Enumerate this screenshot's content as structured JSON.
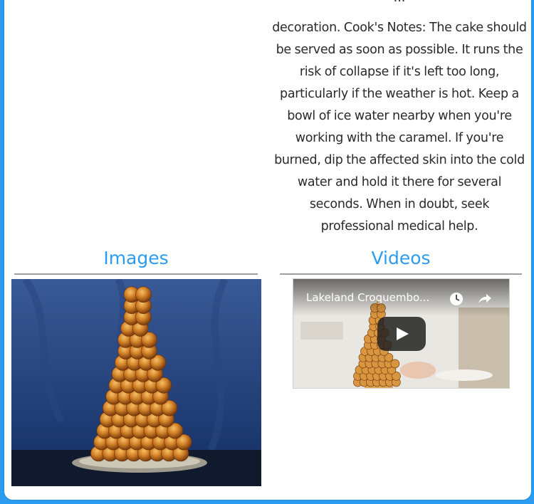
{
  "notes": {
    "partial_top": "...",
    "text": "decoration. Cook's Notes: The cake should be served as soon as possible. It runs the risk of collapse if it's left too long, particularly if the weather is hot. Keep a bowl of ice water nearby when you're working with the caramel. If you're burned, dip the affected skin into the cold water and hold it there for several seconds. When in doubt, seek professional medical help."
  },
  "images": {
    "title": "Images",
    "photo_icon": "croquembouche-photo"
  },
  "videos": {
    "title": "Videos",
    "video_title": "Lakeland Croquembo...",
    "icons": [
      "clock-icon",
      "share-icon",
      "play-icon"
    ]
  },
  "colors": {
    "accent": "#2b9cf0",
    "rule": "#9e9e9e",
    "text": "#2a2a2a"
  }
}
